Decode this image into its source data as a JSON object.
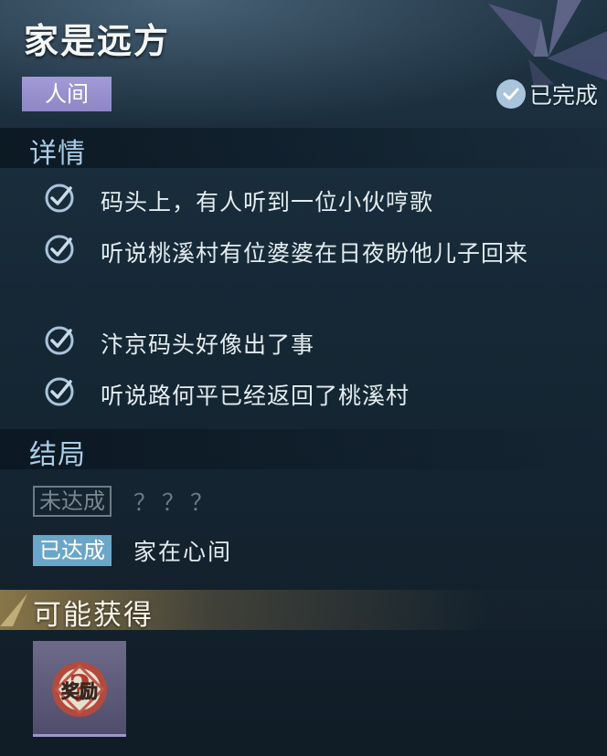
{
  "quest": {
    "title": "家是远方",
    "category": "人间",
    "status": "已完成"
  },
  "details": {
    "header": "详情",
    "items": [
      "码头上，有人听到一位小伙哼歌",
      "听说桃溪村有位婆婆在日夜盼他儿子回来",
      "汴京码头好像出了事",
      "听说路何平已经返回了桃溪村"
    ]
  },
  "endings": {
    "header": "结局",
    "locked": {
      "tag": "未达成",
      "text": "？？？"
    },
    "achieved": {
      "tag": "已达成",
      "text": "家在心间"
    }
  },
  "rewards": {
    "header": "可能获得",
    "item_label": "奖励",
    "item_mark": "?"
  },
  "colors": {
    "background": "#162836",
    "section_title": "#a9cde6",
    "category_tag": "#9a92d0",
    "achieved_tag": "#6aa6c8",
    "check_mark": "#a9c4db",
    "rewards_accent": "#b09252",
    "reward_slot": "#5f5c7d"
  }
}
